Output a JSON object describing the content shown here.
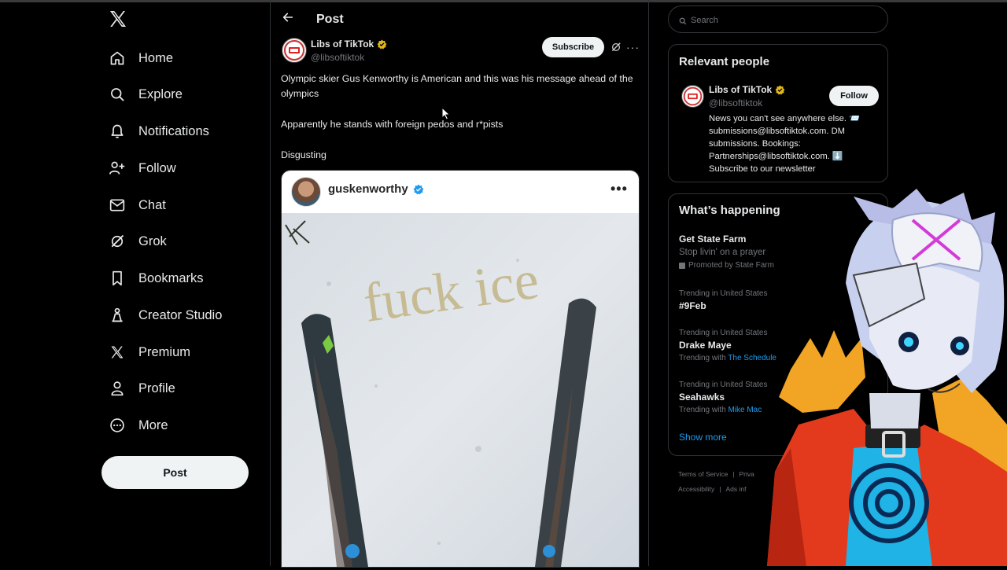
{
  "sidebar": {
    "logo": "x-logo",
    "items": [
      {
        "label": "Home",
        "icon": "home-icon"
      },
      {
        "label": "Explore",
        "icon": "search-icon"
      },
      {
        "label": "Notifications",
        "icon": "bell-icon"
      },
      {
        "label": "Follow",
        "icon": "person-plus-icon"
      },
      {
        "label": "Chat",
        "icon": "mail-icon"
      },
      {
        "label": "Grok",
        "icon": "grok-icon"
      },
      {
        "label": "Bookmarks",
        "icon": "bookmark-icon"
      },
      {
        "label": "Creator Studio",
        "icon": "creator-studio-icon"
      },
      {
        "label": "Premium",
        "icon": "x-premium-icon"
      },
      {
        "label": "Profile",
        "icon": "person-icon"
      },
      {
        "label": "More",
        "icon": "more-circle-icon"
      }
    ],
    "post_button": "Post"
  },
  "main": {
    "header_title": "Post",
    "post": {
      "author": "Libs of TikTok",
      "handle": "@libsoftiktok",
      "subscribe_label": "Subscribe",
      "more": "···",
      "paragraphs": [
        "Olympic skier Gus Kenworthy is American and this was his message ahead of the olympics",
        "Apparently he stands with foreign pedos and r*pists",
        "Disgusting"
      ],
      "embed": {
        "username": "guskenworthy",
        "more": "•••",
        "photo_text": "fuck ice"
      }
    }
  },
  "right": {
    "search_placeholder": "Search",
    "relevant": {
      "title": "Relevant people",
      "name": "Libs of TikTok",
      "handle": "@libsoftiktok",
      "follow_label": "Follow",
      "bio": "News you can't see anywhere else. 📨 submissions@libsoftiktok.com. DM submissions. Bookings: Partnerships@libsoftiktok.com. ⬇️ Subscribe to our newsletter"
    },
    "happening": {
      "title": "What’s happening",
      "promo": {
        "title": "Get State Farm",
        "subtitle": "Stop livin' on a prayer",
        "promoted": "Promoted by State Farm"
      },
      "trends": [
        {
          "meta": "Trending in United States",
          "title": "#9Feb",
          "with_prefix": "",
          "with_link": ""
        },
        {
          "meta": "Trending in United States",
          "title": "Drake Maye",
          "with_prefix": "Trending with",
          "with_link": "The Schedule"
        },
        {
          "meta": "Trending in United States",
          "title": "Seahawks",
          "with_prefix": "Trending with",
          "with_link": "Mike Mac"
        }
      ],
      "show_more": "Show more"
    },
    "footer": {
      "terms": "Terms of Service",
      "privacy": "Priva",
      "accessibility": "Accessibility",
      "ads": "Ads inf"
    }
  },
  "colors": {
    "background": "#000000",
    "accent": "#1d9bf0",
    "gold_badge": "#e2b719",
    "border": "#2f3336"
  }
}
